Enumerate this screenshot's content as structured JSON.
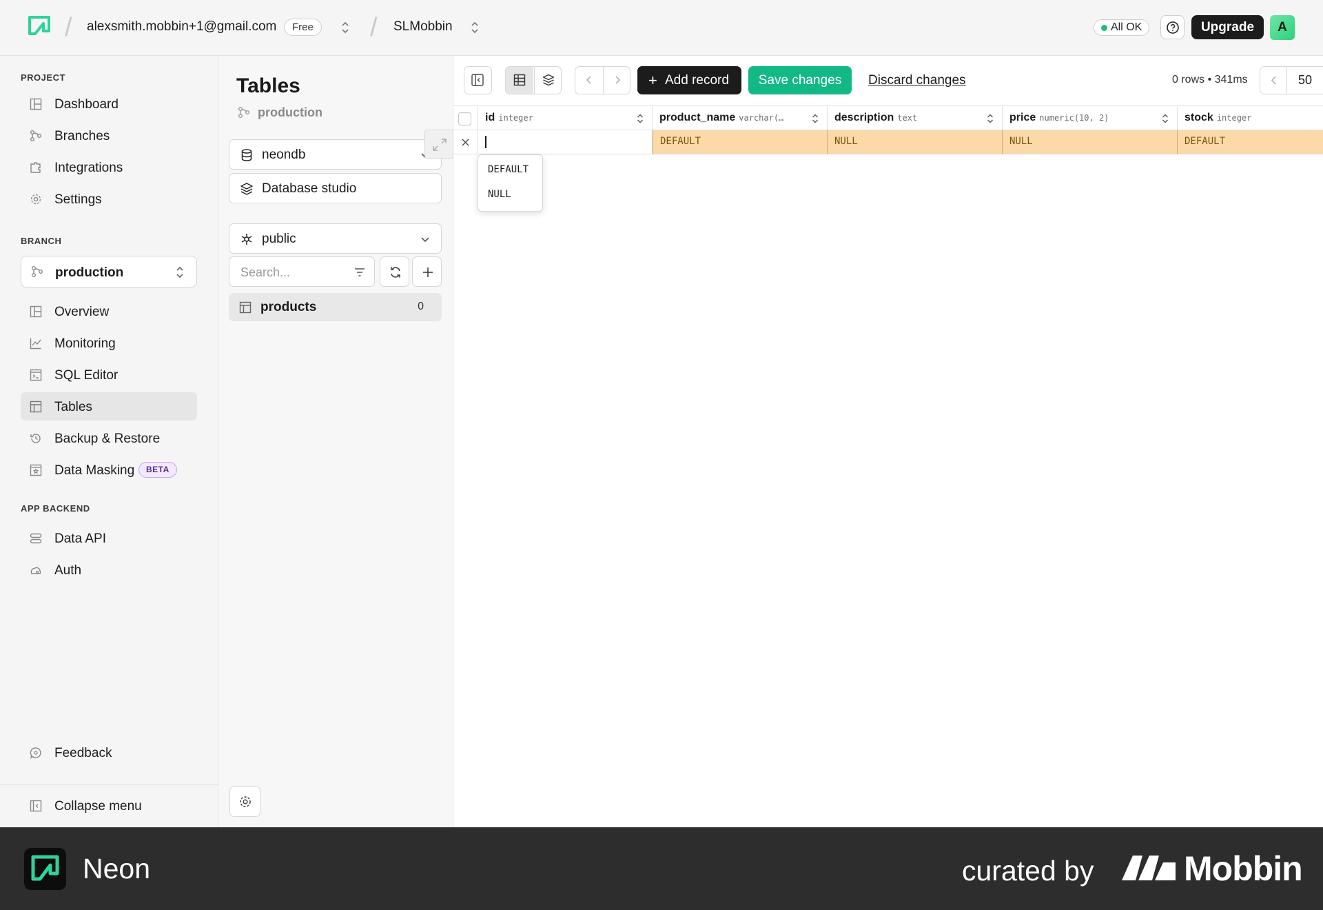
{
  "topbar": {
    "account": "alexsmith.mobbin+1@gmail.com",
    "plan_badge": "Free",
    "project": "SLMobbin",
    "status": "All OK",
    "upgrade_label": "Upgrade",
    "avatar_letter": "A",
    "accent": "#1fbf74"
  },
  "sidebar": {
    "project_section": "PROJECT",
    "project_items": [
      {
        "label": "Dashboard",
        "icon": "dashboard-icon"
      },
      {
        "label": "Branches",
        "icon": "branches-icon"
      },
      {
        "label": "Integrations",
        "icon": "integrations-icon"
      },
      {
        "label": "Settings",
        "icon": "gear-icon"
      }
    ],
    "branch_section": "BRANCH",
    "branch_selected": "production",
    "branch_items": [
      {
        "label": "Overview",
        "icon": "overview-icon"
      },
      {
        "label": "Monitoring",
        "icon": "monitoring-icon"
      },
      {
        "label": "SQL Editor",
        "icon": "sql-editor-icon"
      },
      {
        "label": "Tables",
        "icon": "tables-icon",
        "active": true
      },
      {
        "label": "Backup & Restore",
        "icon": "history-icon"
      },
      {
        "label": "Data Masking",
        "icon": "data-masking-icon",
        "badge": "BETA"
      }
    ],
    "backend_section": "APP BACKEND",
    "backend_items": [
      {
        "label": "Data API",
        "icon": "data-api-icon"
      },
      {
        "label": "Auth",
        "icon": "auth-icon"
      }
    ],
    "feedback": "Feedback",
    "collapse": "Collapse menu"
  },
  "tables_panel": {
    "title": "Tables",
    "branch": "production",
    "database": "neondb",
    "studio": "Database studio",
    "schema": "public",
    "search_placeholder": "Search...",
    "tables": [
      {
        "name": "products",
        "count": "0"
      }
    ]
  },
  "toolbar": {
    "add_record": "Add record",
    "save_changes": "Save changes",
    "discard_changes": "Discard changes",
    "row_info": "0 rows • 341ms",
    "page_size": "50",
    "save_color": "#12b886"
  },
  "grid": {
    "columns": [
      {
        "name": "id",
        "type": "integer"
      },
      {
        "name": "product_name",
        "type": "varchar(…"
      },
      {
        "name": "description",
        "type": "text"
      },
      {
        "name": "price",
        "type": "numeric(10, 2)"
      },
      {
        "name": "stock",
        "type": "integer"
      }
    ],
    "new_row": [
      "",
      "DEFAULT",
      "NULL",
      "NULL",
      "DEFAULT"
    ],
    "dropdown_options": [
      "DEFAULT",
      "NULL"
    ],
    "pending_color": "#fcd9a8"
  },
  "footer": {
    "app_name": "Neon",
    "curated_by": "curated by",
    "brand": "Mobbin"
  }
}
